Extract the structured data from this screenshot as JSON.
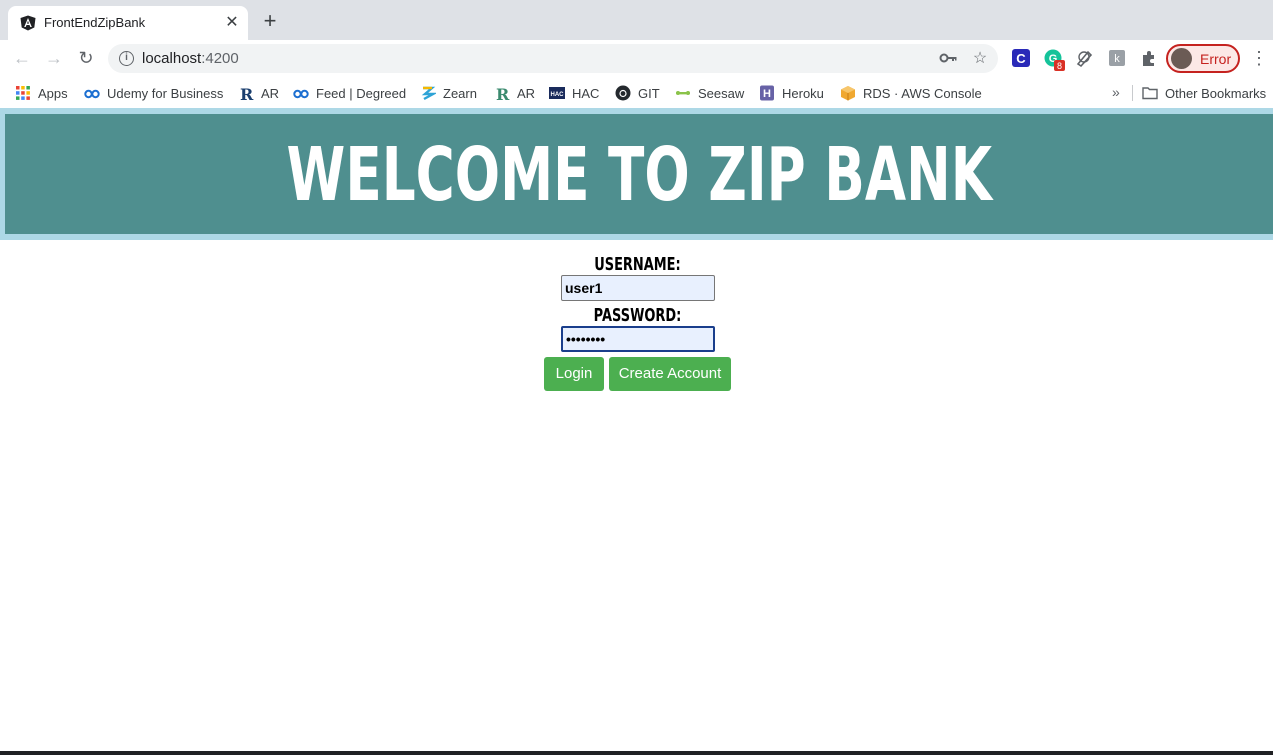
{
  "browser": {
    "tab_title": "FrontEndZipBank",
    "url_host": "localhost",
    "url_path": ":4200",
    "profile_label": "Error",
    "extension_badge": "8"
  },
  "bookmarks": [
    {
      "label": "Apps",
      "icon": "apps-grid-icon"
    },
    {
      "label": "Udemy for Business",
      "icon": "udemy-icon"
    },
    {
      "label": "AR",
      "icon": "r-icon"
    },
    {
      "label": "Feed | Degreed",
      "icon": "degreed-icon"
    },
    {
      "label": "Zearn",
      "icon": "zearn-icon"
    },
    {
      "label": "AR",
      "icon": "r-icon"
    },
    {
      "label": "HAC",
      "icon": "hac-icon"
    },
    {
      "label": "GIT",
      "icon": "github-icon"
    },
    {
      "label": "Seesaw",
      "icon": "seesaw-icon"
    },
    {
      "label": "Heroku",
      "icon": "heroku-icon"
    },
    {
      "label": "RDS · AWS Console",
      "icon": "aws-icon"
    }
  ],
  "other_bookmarks": "Other Bookmarks",
  "overflow": "»",
  "page": {
    "banner_title": "WELCOME TO ZIP BANK",
    "username_label": "USERNAME:",
    "username_value": "user1",
    "password_label": "PASSWORD:",
    "password_value": "••••••••",
    "login_button": "Login",
    "create_account_button": "Create Account"
  },
  "colors": {
    "banner_bg": "#4f8f8f",
    "banner_border": "#add8e6",
    "button_bg": "#4caf50"
  }
}
